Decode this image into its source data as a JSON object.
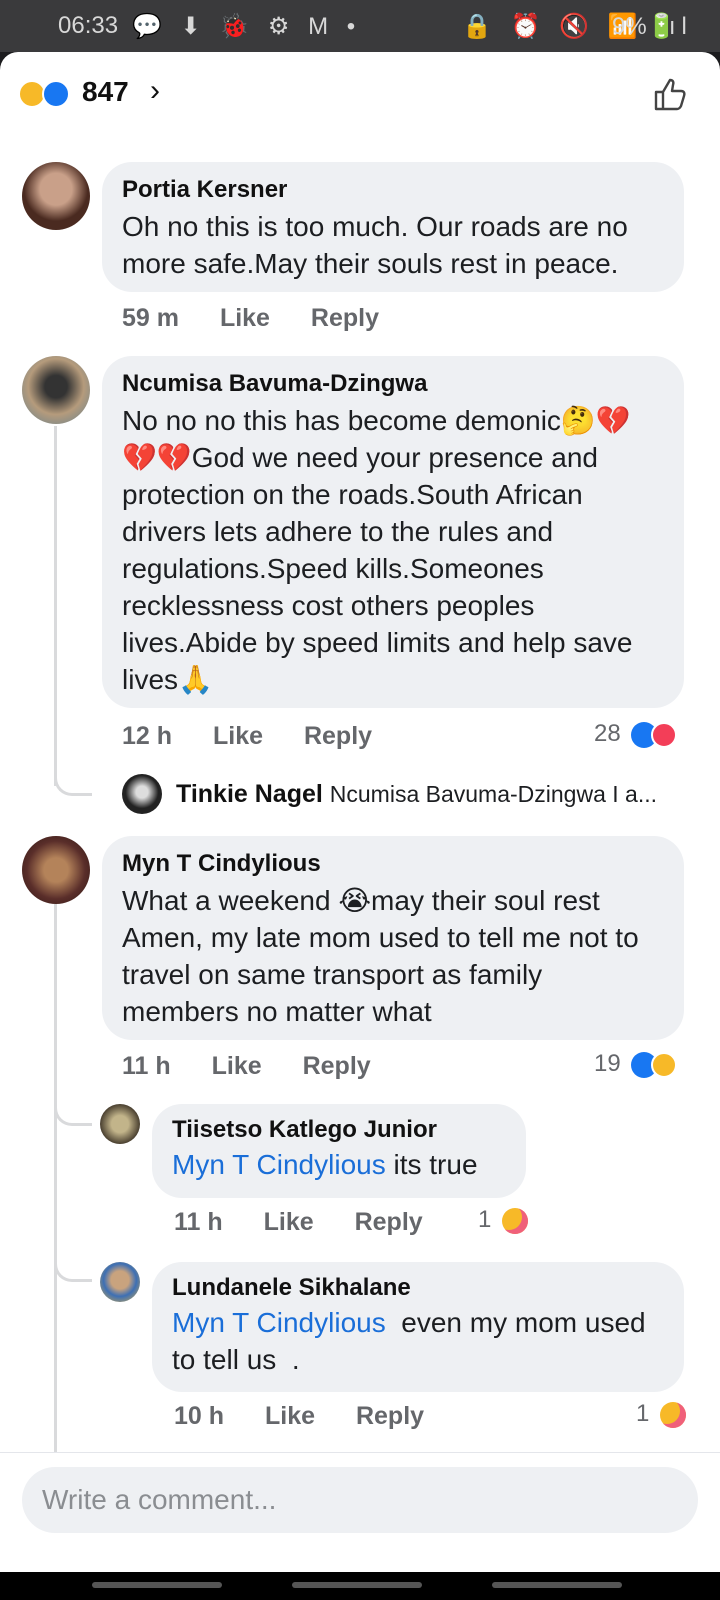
{
  "status_bar": {
    "time": "06:33",
    "left_icons": "💬 ⬇ 🐞 ⚙ M •",
    "right_icons": "🔒 ⏰ 🔇 📶 .ıl",
    "battery": "9%🔋"
  },
  "header": {
    "reaction_count": "847",
    "reaction_colors": [
      "#f7b928",
      "#1877f2"
    ]
  },
  "comments": [
    {
      "name": "Portia Kersner",
      "text": "Oh no this is too much. Our roads are no more safe.May their souls rest in peace.",
      "time": "59 m",
      "like": "Like",
      "reply": "Reply"
    },
    {
      "name": "Ncumisa Bavuma-Dzingwa",
      "text": "No  no no this has become demonic🤔💔💔💔God we need your presence and protection on the roads.South African drivers lets adhere to the rules and regulations.Speed kills.Someones recklessness cost others peoples lives.Abide by speed limits and help save lives🙏",
      "time": "12 h",
      "like": "Like",
      "reply": "Reply",
      "reactions": "28",
      "reply_preview": {
        "name": "Tinkie Nagel",
        "text": "Ncumisa Bavuma-Dzingwa I a..."
      }
    },
    {
      "name": "Myn T Cindylious",
      "text": "What a weekend 😭may their soul rest Amen, my late mom used to tell me not to travel on same transport as family members no matter what",
      "time": "11 h",
      "like": "Like",
      "reply": "Reply",
      "reactions": "19",
      "replies": [
        {
          "name": "Tiisetso Katlego Junior",
          "mention": "Myn T Cindylious",
          "text": " its true",
          "time": "11 h",
          "like": "Like",
          "reply": "Reply",
          "reactions": "1"
        },
        {
          "name": "Lundanele Sikhalane",
          "mention": "Myn T Cindylious",
          "text": "  even my mom used to tell us  .",
          "time": "10 h",
          "like": "Like",
          "reply": "Reply",
          "reactions": "1"
        }
      ]
    }
  ],
  "composer": {
    "placeholder": "Write a comment..."
  }
}
